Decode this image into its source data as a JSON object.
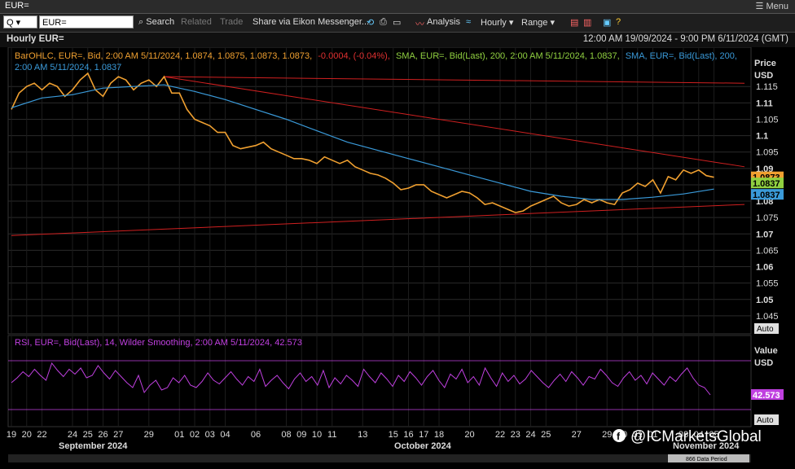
{
  "window": {
    "title": "EUR=",
    "menu_label": "Menu"
  },
  "toolbar": {
    "quote_box": "Q",
    "ric_value": "EUR=",
    "search": "Search",
    "related": "Related",
    "trade": "Trade",
    "share": "Share via Eikon Messenger...",
    "analysis": "Analysis",
    "interval": "Hourly",
    "range": "Range"
  },
  "header": {
    "chart_title": "Hourly EUR=",
    "date_range": "12:00 AM 19/09/2024 - 9:00 PM 6/11/2024 (GMT)"
  },
  "legend": {
    "ohlc_prefix": "BarOHLC, EUR=, Bid, 2:00 AM 5/11/2024, 1.0874, 1.0875, 1.0873, 1.0873,",
    "ohlc_change": "-0.0004, (-0.04%),",
    "sma1": "SMA, EUR=, Bid(Last), 200, 2:00 AM 5/11/2024, 1.0837,",
    "sma2_line1": "SMA, EUR=, Bid(Last), 200,",
    "sma2_line2": "2:00 AM 5/11/2024, 1.0837",
    "rsi": "RSI, EUR=, Bid(Last), 14, Wilder Smoothing, 2:00 AM 5/11/2024, 42.573"
  },
  "axis": {
    "price_title": "Price",
    "price_unit": "USD",
    "rsi_title": "Value",
    "rsi_unit": "USD",
    "auto": "Auto",
    "month_sep": "September 2024",
    "month_oct": "October 2024",
    "month_nov": "November 2024",
    "data_period": "866 Data Period"
  },
  "badges": {
    "last_price": "1.0873",
    "sma_a": "1.0837",
    "sma_b": "1.0837",
    "rsi": "42.573"
  },
  "watermark": "@ICMarketsGlobal",
  "colors": {
    "price": "#f0a030",
    "sma_green": "#90d040",
    "sma_blue": "#3a9ad9",
    "trend": "#d02020",
    "rsi": "#c040e0"
  },
  "chart_data": {
    "type": "line",
    "title": "Hourly EUR=",
    "ylabel": "Price USD",
    "ylim": [
      1.04,
      1.125
    ],
    "y_ticks": [
      "1.115",
      "1.11",
      "1.105",
      "1.1",
      "1.095",
      "1.09",
      "1.085",
      "1.08",
      "1.075",
      "1.07",
      "1.065",
      "1.06",
      "1.055",
      "1.05",
      "1.045"
    ],
    "x_ticks": [
      "19",
      "20",
      "22",
      "24",
      "25",
      "26",
      "27",
      "29",
      "01",
      "02",
      "03",
      "04",
      "06",
      "08",
      "09",
      "10",
      "11",
      "13",
      "15",
      "16",
      "17",
      "18",
      "20",
      "22",
      "23",
      "24",
      "25",
      "27",
      "29",
      "30",
      "31",
      "01",
      "03",
      "04",
      "05"
    ],
    "x_index": [
      0,
      1,
      2,
      4,
      5,
      6,
      7,
      9,
      11,
      12,
      13,
      14,
      16,
      18,
      19,
      20,
      21,
      23,
      25,
      26,
      27,
      28,
      30,
      32,
      33,
      34,
      35,
      37,
      39,
      40,
      41,
      42,
      44,
      45,
      46
    ],
    "series": [
      {
        "values": [
          [
            0,
            1.108
          ],
          [
            0.5,
            1.113
          ],
          [
            1,
            1.115
          ],
          [
            1.5,
            1.116
          ],
          [
            2,
            1.114
          ],
          [
            2.5,
            1.116
          ],
          [
            3,
            1.115
          ],
          [
            3.5,
            1.112
          ],
          [
            4,
            1.114
          ],
          [
            4.5,
            1.117
          ],
          [
            5,
            1.119
          ],
          [
            5.5,
            1.114
          ],
          [
            6,
            1.112
          ],
          [
            6.5,
            1.116
          ],
          [
            7,
            1.118
          ],
          [
            7.5,
            1.117
          ],
          [
            8,
            1.114
          ],
          [
            8.5,
            1.116
          ],
          [
            9,
            1.117
          ],
          [
            9.5,
            1.115
          ],
          [
            10,
            1.118
          ],
          [
            10.5,
            1.113
          ],
          [
            11,
            1.113
          ],
          [
            11.5,
            1.108
          ],
          [
            12,
            1.105
          ],
          [
            12.5,
            1.104
          ],
          [
            13,
            1.103
          ],
          [
            13.5,
            1.101
          ],
          [
            14,
            1.101
          ],
          [
            14.5,
            1.097
          ],
          [
            15,
            1.096
          ],
          [
            15.5,
            1.0965
          ],
          [
            16,
            1.097
          ],
          [
            16.5,
            1.098
          ],
          [
            17,
            1.096
          ],
          [
            17.5,
            1.095
          ],
          [
            18,
            1.094
          ],
          [
            18.5,
            1.093
          ],
          [
            19,
            1.093
          ],
          [
            19.5,
            1.0925
          ],
          [
            20,
            1.0915
          ],
          [
            20.5,
            1.0935
          ],
          [
            21,
            1.0925
          ],
          [
            21.5,
            1.0915
          ],
          [
            22,
            1.0925
          ],
          [
            22.5,
            1.0905
          ],
          [
            23,
            1.0895
          ],
          [
            23.5,
            1.0885
          ],
          [
            24,
            1.088
          ],
          [
            24.5,
            1.087
          ],
          [
            25,
            1.0855
          ],
          [
            25.5,
            1.0835
          ],
          [
            26,
            1.084
          ],
          [
            26.5,
            1.085
          ],
          [
            27,
            1.085
          ],
          [
            27.5,
            1.083
          ],
          [
            28,
            1.082
          ],
          [
            28.5,
            1.081
          ],
          [
            29,
            1.082
          ],
          [
            29.5,
            1.083
          ],
          [
            30,
            1.0825
          ],
          [
            30.5,
            1.081
          ],
          [
            31,
            1.079
          ],
          [
            31.5,
            1.0795
          ],
          [
            32,
            1.0785
          ],
          [
            32.5,
            1.0775
          ],
          [
            33,
            1.0765
          ],
          [
            33.5,
            1.077
          ],
          [
            34,
            1.0785
          ],
          [
            34.5,
            1.0795
          ],
          [
            35,
            1.0805
          ],
          [
            35.5,
            1.0815
          ],
          [
            36,
            1.0795
          ],
          [
            36.5,
            1.0785
          ],
          [
            37,
            1.079
          ],
          [
            37.5,
            1.0805
          ],
          [
            38,
            1.0795
          ],
          [
            38.5,
            1.0805
          ],
          [
            39,
            1.0795
          ],
          [
            39.5,
            1.079
          ],
          [
            40,
            1.0825
          ],
          [
            40.5,
            1.0835
          ],
          [
            41,
            1.0855
          ],
          [
            41.5,
            1.0845
          ],
          [
            42,
            1.0865
          ],
          [
            42.5,
            1.0825
          ],
          [
            43,
            1.0875
          ],
          [
            43.5,
            1.0865
          ],
          [
            44,
            1.0895
          ],
          [
            44.5,
            1.0885
          ],
          [
            45,
            1.0895
          ],
          [
            45.5,
            1.0878
          ],
          [
            46,
            1.0873
          ]
        ]
      },
      {
        "values": [
          [
            0,
            1.1085
          ],
          [
            2,
            1.1115
          ],
          [
            4,
            1.1125
          ],
          [
            6,
            1.1145
          ],
          [
            8,
            1.115
          ],
          [
            10,
            1.1155
          ],
          [
            12,
            1.1135
          ],
          [
            14,
            1.111
          ],
          [
            16,
            1.108
          ],
          [
            18,
            1.105
          ],
          [
            20,
            1.1015
          ],
          [
            22,
            1.098
          ],
          [
            24,
            1.0955
          ],
          [
            26,
            1.093
          ],
          [
            28,
            1.0905
          ],
          [
            30,
            1.088
          ],
          [
            32,
            1.0855
          ],
          [
            34,
            1.083
          ],
          [
            36,
            1.0815
          ],
          [
            38,
            1.0805
          ],
          [
            40,
            1.0805
          ],
          [
            42,
            1.0812
          ],
          [
            44,
            1.0822
          ],
          [
            46,
            1.0837
          ]
        ]
      }
    ],
    "trendlines": [
      {
        "from": [
          0,
          1.0695
        ],
        "to": [
          48,
          1.079
        ]
      },
      {
        "from": [
          10,
          1.118
        ],
        "to": [
          48,
          1.0905
        ]
      },
      {
        "from": [
          10,
          1.118
        ],
        "to": [
          48,
          1.116
        ]
      }
    ],
    "rsi": {
      "ylim": [
        20,
        80
      ],
      "bands": [
        70,
        30
      ],
      "values": [
        52,
        56,
        61,
        57,
        63,
        58,
        54,
        68,
        62,
        57,
        63,
        59,
        64,
        56,
        58,
        66,
        60,
        55,
        62,
        57,
        52,
        48,
        58,
        44,
        50,
        54,
        46,
        48,
        56,
        52,
        58,
        50,
        48,
        53,
        60,
        54,
        51,
        56,
        61,
        55,
        50,
        57,
        53,
        63,
        49,
        54,
        58,
        52,
        47,
        55,
        60,
        53,
        57,
        50,
        62,
        48,
        56,
        51,
        58,
        54,
        49,
        63,
        57,
        52,
        60,
        55,
        49,
        58,
        53,
        61,
        56,
        50,
        57,
        62,
        54,
        48,
        59,
        55,
        63,
        52,
        57,
        50,
        64,
        56,
        49,
        60,
        53,
        58,
        51,
        55,
        62,
        57,
        52,
        48,
        54,
        59,
        53,
        61,
        56,
        50,
        57,
        55,
        63,
        58,
        52,
        49,
        56,
        61,
        54,
        58,
        51,
        60,
        55,
        50,
        57,
        53,
        59,
        64,
        56,
        50,
        48,
        42
      ]
    }
  }
}
